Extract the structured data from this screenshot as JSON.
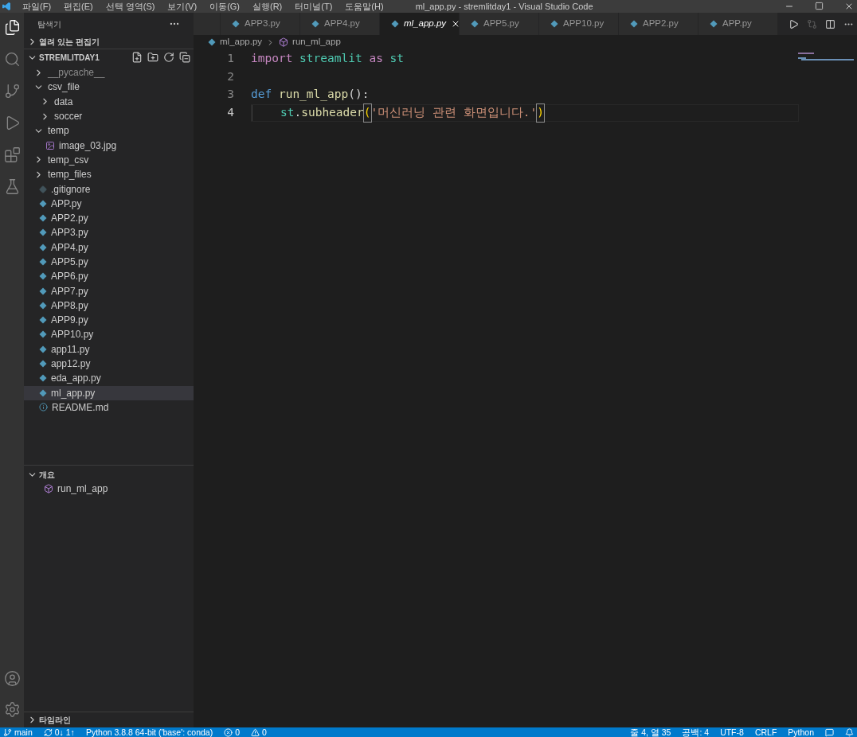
{
  "window": {
    "title": "ml_app.py - stremlitday1 - Visual Studio Code"
  },
  "menu": [
    "파일(F)",
    "편집(E)",
    "선택 영역(S)",
    "보기(V)",
    "이동(G)",
    "실행(R)",
    "터미널(T)",
    "도움말(H)"
  ],
  "sidebar": {
    "title": "탐색기",
    "open_editors": {
      "label": "열려 있는 편집기",
      "expanded": false
    },
    "project": {
      "label": "STREMLITDAY1",
      "expanded": true
    },
    "items": [
      {
        "name": "__pycache__",
        "kind": "folder",
        "expanded": false,
        "dimmed": true,
        "selected": false
      },
      {
        "name": "csv_file",
        "kind": "folder",
        "expanded": true,
        "dimmed": false,
        "selected": false,
        "children": [
          {
            "name": "data",
            "kind": "folder",
            "expanded": false,
            "dimmed": false,
            "selected": false
          },
          {
            "name": "soccer",
            "kind": "folder",
            "expanded": false,
            "dimmed": false,
            "selected": false
          }
        ]
      },
      {
        "name": "temp",
        "kind": "folder",
        "expanded": true,
        "dimmed": false,
        "selected": false,
        "children": [
          {
            "name": "image_03.jpg",
            "kind": "image",
            "dimmed": false,
            "selected": false
          }
        ]
      },
      {
        "name": "temp_csv",
        "kind": "folder",
        "expanded": false,
        "dimmed": false,
        "selected": false
      },
      {
        "name": "temp_files",
        "kind": "folder",
        "expanded": false,
        "dimmed": false,
        "selected": false
      },
      {
        "name": ".gitignore",
        "kind": "git",
        "dimmed": false,
        "selected": false
      },
      {
        "name": "APP.py",
        "kind": "python",
        "dimmed": false,
        "selected": false
      },
      {
        "name": "APP2.py",
        "kind": "python",
        "dimmed": false,
        "selected": false
      },
      {
        "name": "APP3.py",
        "kind": "python",
        "dimmed": false,
        "selected": false
      },
      {
        "name": "APP4.py",
        "kind": "python",
        "dimmed": false,
        "selected": false
      },
      {
        "name": "APP5.py",
        "kind": "python",
        "dimmed": false,
        "selected": false
      },
      {
        "name": "APP6.py",
        "kind": "python",
        "dimmed": false,
        "selected": false
      },
      {
        "name": "APP7.py",
        "kind": "python",
        "dimmed": false,
        "selected": false
      },
      {
        "name": "APP8.py",
        "kind": "python",
        "dimmed": false,
        "selected": false
      },
      {
        "name": "APP9.py",
        "kind": "python",
        "dimmed": false,
        "selected": false
      },
      {
        "name": "APP10.py",
        "kind": "python",
        "dimmed": false,
        "selected": false
      },
      {
        "name": "app11.py",
        "kind": "python",
        "dimmed": false,
        "selected": false
      },
      {
        "name": "app12.py",
        "kind": "python",
        "dimmed": false,
        "selected": false
      },
      {
        "name": "eda_app.py",
        "kind": "python",
        "dimmed": false,
        "selected": false
      },
      {
        "name": "ml_app.py",
        "kind": "python",
        "dimmed": false,
        "selected": true
      },
      {
        "name": "README.md",
        "kind": "info",
        "dimmed": false,
        "selected": false
      }
    ],
    "outline": {
      "label": "개요",
      "expanded": true,
      "items": [
        "run_ml_app"
      ]
    },
    "timeline": {
      "label": "타임라인",
      "expanded": false
    }
  },
  "tabs": [
    {
      "label": "APP3.py",
      "selected": false
    },
    {
      "label": "APP4.py",
      "selected": false
    },
    {
      "label": "ml_app.py",
      "selected": true
    },
    {
      "label": "APP5.py",
      "selected": false
    },
    {
      "label": "APP10.py",
      "selected": false
    },
    {
      "label": "APP2.py",
      "selected": false
    },
    {
      "label": "APP.py",
      "selected": false
    }
  ],
  "breadcrumb": [
    "ml_app.py",
    "run_ml_app"
  ],
  "code": [
    {
      "number": "1",
      "active": false,
      "indent": false,
      "tokens": [
        {
          "text": "import",
          "kind": "keyword"
        },
        {
          "text": " streamlit ",
          "kind": "module"
        },
        {
          "text": "as",
          "kind": "keyword"
        },
        {
          "text": " st",
          "kind": "module"
        }
      ]
    },
    {
      "number": "2",
      "active": false,
      "indent": false
    },
    {
      "number": "3",
      "active": false,
      "indent": false,
      "tokens": [
        {
          "text": "def",
          "kind": "storage"
        },
        {
          "text": " run_ml_app",
          "kind": "function"
        },
        {
          "text": "():",
          "kind": "plain"
        }
      ]
    },
    {
      "number": "4",
      "active": true,
      "indent": true,
      "tokens": [
        {
          "text": "st",
          "kind": "module"
        },
        {
          "text": ".",
          "kind": "plain"
        },
        {
          "text": "subheader",
          "kind": "function"
        },
        {
          "text": "(",
          "kind": "bracket"
        },
        {
          "text": "'머신러닝 관련 화면입니다.'",
          "kind": "string"
        },
        {
          "text": ")",
          "kind": "bracket"
        }
      ]
    }
  ],
  "status_bar": [
    {
      "text": "main",
      "kind": "branch"
    },
    {
      "text": "0↓ 1↑",
      "kind": "sync"
    },
    {
      "text": "Python 3.8.8 64-bit ('base': conda)",
      "kind": "plain"
    },
    {
      "text": "0",
      "kind": "errors"
    },
    {
      "text": "0",
      "kind": "warnings"
    }
  ],
  "status_bar_right": [
    "줄 4, 열 35",
    "공백: 4",
    "UTF-8",
    "CRLF",
    "Python"
  ]
}
